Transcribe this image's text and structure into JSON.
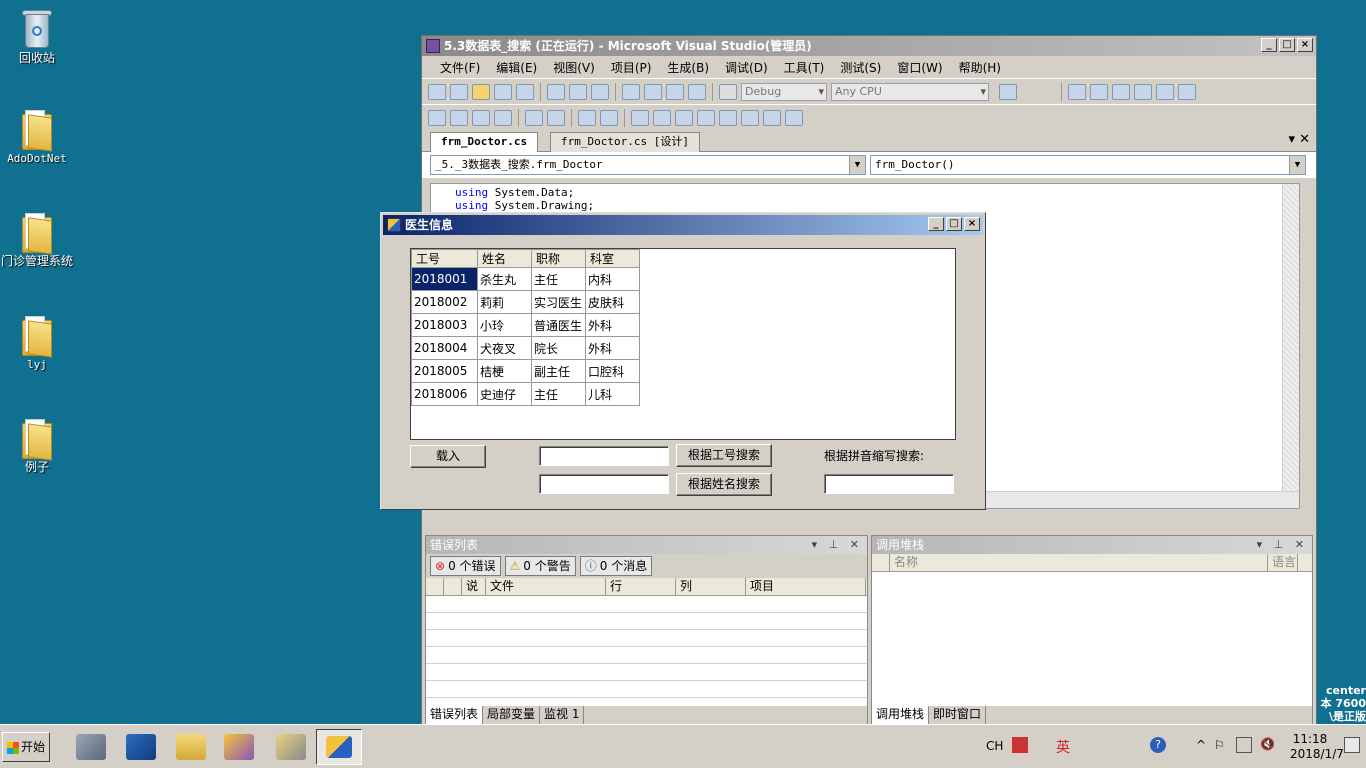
{
  "desktop": {
    "icons": [
      {
        "label": "回收站"
      },
      {
        "label": "AdoDotNet"
      },
      {
        "label": "门诊管理系统"
      },
      {
        "label": "lyj"
      },
      {
        "label": "例子"
      }
    ],
    "watermark": [
      "center",
      "本 7600",
      "\\是正版"
    ]
  },
  "vs": {
    "title": "5.3数据表_搜索 (正在运行) - Microsoft Visual Studio(管理员)",
    "menu": [
      "文件(F)",
      "编辑(E)",
      "视图(V)",
      "项目(P)",
      "生成(B)",
      "调试(D)",
      "工具(T)",
      "测试(S)",
      "窗口(W)",
      "帮助(H)"
    ],
    "config_combo": "Debug",
    "platform_combo": "Any CPU",
    "tabs": [
      {
        "label": "frm_Doctor.cs"
      },
      {
        "label": "frm_Doctor.cs [设计]"
      }
    ],
    "nav_left": "_5._3数据表_搜索.frm_Doctor",
    "nav_right": "frm_Doctor()",
    "code": [
      {
        "kw": "using",
        "rest": " System.Data;"
      },
      {
        "kw": "using",
        "rest": " System.Drawing;"
      }
    ]
  },
  "error_list": {
    "title": "错误列表",
    "errors": "0 个错误",
    "warnings": "0 个警告",
    "messages": "0 个消息",
    "columns": [
      "",
      "",
      "说",
      "文件",
      "行",
      "列",
      "项目"
    ],
    "bottom_tabs": [
      "错误列表",
      "局部变量",
      "监视 1"
    ]
  },
  "call_stack": {
    "title": "调用堆栈",
    "columns": [
      "名称",
      "语言"
    ],
    "bottom_tabs": [
      "调用堆栈",
      "即时窗口"
    ]
  },
  "form": {
    "title": "医生信息",
    "columns": [
      "工号",
      "姓名",
      "职称",
      "科室"
    ],
    "rows": [
      [
        "2018001",
        "杀生丸",
        "主任",
        "内科"
      ],
      [
        "2018002",
        "莉莉",
        "实习医生",
        "皮肤科"
      ],
      [
        "2018003",
        "小玲",
        "普通医生",
        "外科"
      ],
      [
        "2018004",
        "犬夜叉",
        "院长",
        "外科"
      ],
      [
        "2018005",
        "桔梗",
        "副主任",
        "口腔科"
      ],
      [
        "2018006",
        "史迪仔",
        "主任",
        "儿科"
      ]
    ],
    "load_button": "载入",
    "search_id_button": "根据工号搜索",
    "search_name_button": "根据姓名搜索",
    "pinyin_label": "根据拼音缩写搜索:",
    "id_value": "",
    "name_value": "",
    "pinyin_value": ""
  },
  "taskbar": {
    "start": "开始",
    "lang": "CH",
    "ime": "英",
    "time": "11:18",
    "date": "2018/1/7"
  }
}
